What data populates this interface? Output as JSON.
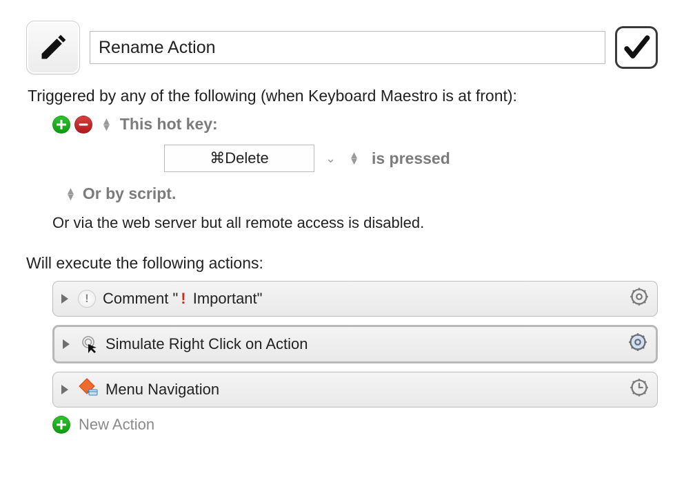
{
  "header": {
    "macro_name": "Rename Action"
  },
  "trigger": {
    "intro": "Triggered by any of the following (when Keyboard Maestro is at front):",
    "hotkey_label": "This hot key:",
    "keystroke": "⌘Delete",
    "condition": "is pressed",
    "script_label": "Or by script.",
    "web_note": "Or via the web server but all remote access is disabled."
  },
  "will_execute": "Will execute the following actions:",
  "actions": [
    {
      "title_pre": "Comment \"",
      "title_post": " Important\"",
      "kind": "comment"
    },
    {
      "title": "Simulate Right Click on Action",
      "kind": "click",
      "selected": true
    },
    {
      "title": "Menu Navigation",
      "kind": "menu"
    }
  ],
  "new_action_label": "New Action"
}
